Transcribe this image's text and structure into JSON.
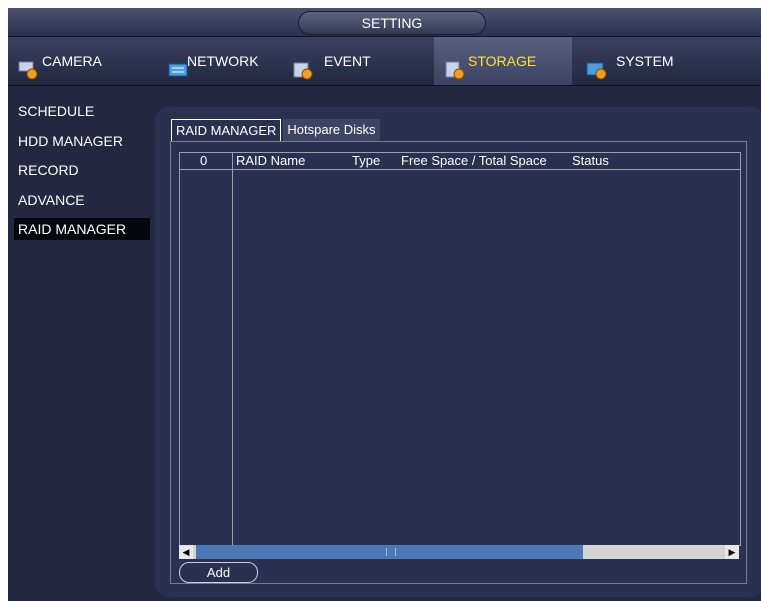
{
  "window": {
    "title": "SETTING"
  },
  "main_tabs": [
    {
      "label": "CAMERA",
      "icon": "camera-gear-icon"
    },
    {
      "label": "NETWORK",
      "icon": "network-icon"
    },
    {
      "label": "EVENT",
      "icon": "event-icon"
    },
    {
      "label": "STORAGE",
      "icon": "storage-gear-icon",
      "active": true
    },
    {
      "label": "SYSTEM",
      "icon": "system-gear-icon"
    }
  ],
  "sidebar": {
    "items": [
      {
        "label": "SCHEDULE"
      },
      {
        "label": "HDD MANAGER"
      },
      {
        "label": "RECORD"
      },
      {
        "label": "ADVANCE"
      },
      {
        "label": "RAID MANAGER",
        "active": true
      }
    ]
  },
  "sub_tabs": [
    {
      "label": "RAID MANAGER",
      "active": true
    },
    {
      "label": "Hotspare Disks"
    }
  ],
  "table": {
    "columns": [
      "0",
      "RAID Name",
      "Type",
      "Free Space / Total Space",
      "Status"
    ],
    "rows": []
  },
  "buttons": {
    "add": "Add"
  },
  "colors": {
    "active_tab_text": "#ffe033",
    "background": "#232840"
  }
}
